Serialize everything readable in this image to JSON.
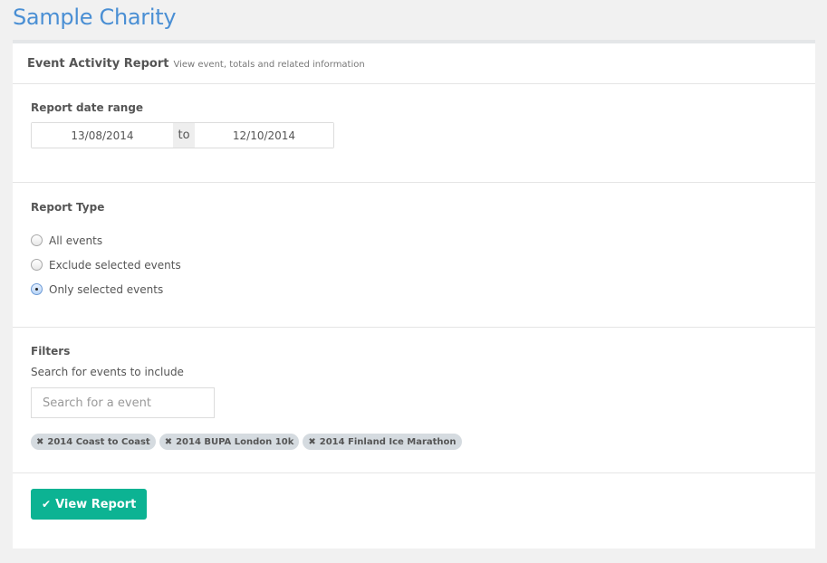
{
  "app": {
    "title": "Sample Charity"
  },
  "panel": {
    "title": "Event Activity Report",
    "subtitle": "View event, totals and related information"
  },
  "date_range": {
    "label": "Report date range",
    "from": "13/08/2014",
    "separator": "to",
    "to": "12/10/2014"
  },
  "report_type": {
    "label": "Report Type",
    "options": [
      {
        "label": "All events",
        "checked": false
      },
      {
        "label": "Exclude selected events",
        "checked": false
      },
      {
        "label": "Only selected events",
        "checked": true
      }
    ]
  },
  "filters": {
    "label": "Filters",
    "description": "Search for events to include",
    "search": {
      "value": "",
      "placeholder": "Search for a event"
    },
    "tags": [
      {
        "label": "2014 Coast to Coast",
        "icon": "remove-icon"
      },
      {
        "label": "2014 BUPA London 10k",
        "icon": "remove-icon"
      },
      {
        "label": "2014 Finland Ice Marathon",
        "icon": "remove-icon"
      }
    ]
  },
  "actions": {
    "view_report_label": "View Report",
    "view_report_icon": "check-icon",
    "button_color": "#0cb393"
  },
  "colors": {
    "title_blue": "#4a8fd4",
    "tag_bg": "#d5dbe0"
  }
}
